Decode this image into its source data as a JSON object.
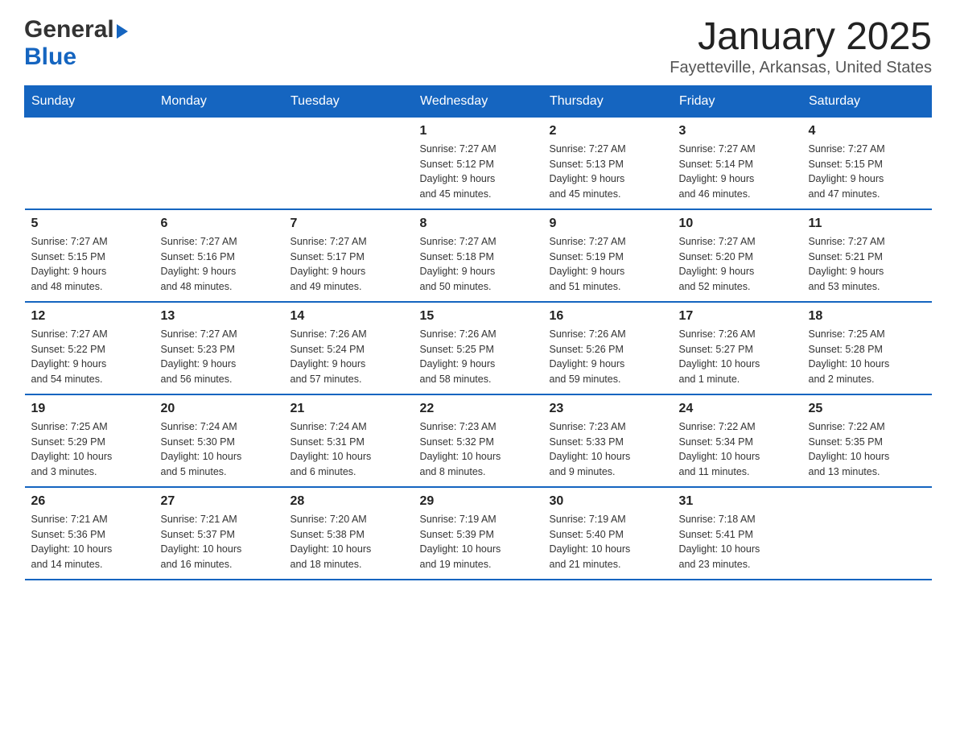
{
  "header": {
    "logo_general": "General",
    "logo_blue": "Blue",
    "title": "January 2025",
    "subtitle": "Fayetteville, Arkansas, United States"
  },
  "days_of_week": [
    "Sunday",
    "Monday",
    "Tuesday",
    "Wednesday",
    "Thursday",
    "Friday",
    "Saturday"
  ],
  "weeks": [
    [
      {
        "day": "",
        "info": ""
      },
      {
        "day": "",
        "info": ""
      },
      {
        "day": "",
        "info": ""
      },
      {
        "day": "1",
        "info": "Sunrise: 7:27 AM\nSunset: 5:12 PM\nDaylight: 9 hours\nand 45 minutes."
      },
      {
        "day": "2",
        "info": "Sunrise: 7:27 AM\nSunset: 5:13 PM\nDaylight: 9 hours\nand 45 minutes."
      },
      {
        "day": "3",
        "info": "Sunrise: 7:27 AM\nSunset: 5:14 PM\nDaylight: 9 hours\nand 46 minutes."
      },
      {
        "day": "4",
        "info": "Sunrise: 7:27 AM\nSunset: 5:15 PM\nDaylight: 9 hours\nand 47 minutes."
      }
    ],
    [
      {
        "day": "5",
        "info": "Sunrise: 7:27 AM\nSunset: 5:15 PM\nDaylight: 9 hours\nand 48 minutes."
      },
      {
        "day": "6",
        "info": "Sunrise: 7:27 AM\nSunset: 5:16 PM\nDaylight: 9 hours\nand 48 minutes."
      },
      {
        "day": "7",
        "info": "Sunrise: 7:27 AM\nSunset: 5:17 PM\nDaylight: 9 hours\nand 49 minutes."
      },
      {
        "day": "8",
        "info": "Sunrise: 7:27 AM\nSunset: 5:18 PM\nDaylight: 9 hours\nand 50 minutes."
      },
      {
        "day": "9",
        "info": "Sunrise: 7:27 AM\nSunset: 5:19 PM\nDaylight: 9 hours\nand 51 minutes."
      },
      {
        "day": "10",
        "info": "Sunrise: 7:27 AM\nSunset: 5:20 PM\nDaylight: 9 hours\nand 52 minutes."
      },
      {
        "day": "11",
        "info": "Sunrise: 7:27 AM\nSunset: 5:21 PM\nDaylight: 9 hours\nand 53 minutes."
      }
    ],
    [
      {
        "day": "12",
        "info": "Sunrise: 7:27 AM\nSunset: 5:22 PM\nDaylight: 9 hours\nand 54 minutes."
      },
      {
        "day": "13",
        "info": "Sunrise: 7:27 AM\nSunset: 5:23 PM\nDaylight: 9 hours\nand 56 minutes."
      },
      {
        "day": "14",
        "info": "Sunrise: 7:26 AM\nSunset: 5:24 PM\nDaylight: 9 hours\nand 57 minutes."
      },
      {
        "day": "15",
        "info": "Sunrise: 7:26 AM\nSunset: 5:25 PM\nDaylight: 9 hours\nand 58 minutes."
      },
      {
        "day": "16",
        "info": "Sunrise: 7:26 AM\nSunset: 5:26 PM\nDaylight: 9 hours\nand 59 minutes."
      },
      {
        "day": "17",
        "info": "Sunrise: 7:26 AM\nSunset: 5:27 PM\nDaylight: 10 hours\nand 1 minute."
      },
      {
        "day": "18",
        "info": "Sunrise: 7:25 AM\nSunset: 5:28 PM\nDaylight: 10 hours\nand 2 minutes."
      }
    ],
    [
      {
        "day": "19",
        "info": "Sunrise: 7:25 AM\nSunset: 5:29 PM\nDaylight: 10 hours\nand 3 minutes."
      },
      {
        "day": "20",
        "info": "Sunrise: 7:24 AM\nSunset: 5:30 PM\nDaylight: 10 hours\nand 5 minutes."
      },
      {
        "day": "21",
        "info": "Sunrise: 7:24 AM\nSunset: 5:31 PM\nDaylight: 10 hours\nand 6 minutes."
      },
      {
        "day": "22",
        "info": "Sunrise: 7:23 AM\nSunset: 5:32 PM\nDaylight: 10 hours\nand 8 minutes."
      },
      {
        "day": "23",
        "info": "Sunrise: 7:23 AM\nSunset: 5:33 PM\nDaylight: 10 hours\nand 9 minutes."
      },
      {
        "day": "24",
        "info": "Sunrise: 7:22 AM\nSunset: 5:34 PM\nDaylight: 10 hours\nand 11 minutes."
      },
      {
        "day": "25",
        "info": "Sunrise: 7:22 AM\nSunset: 5:35 PM\nDaylight: 10 hours\nand 13 minutes."
      }
    ],
    [
      {
        "day": "26",
        "info": "Sunrise: 7:21 AM\nSunset: 5:36 PM\nDaylight: 10 hours\nand 14 minutes."
      },
      {
        "day": "27",
        "info": "Sunrise: 7:21 AM\nSunset: 5:37 PM\nDaylight: 10 hours\nand 16 minutes."
      },
      {
        "day": "28",
        "info": "Sunrise: 7:20 AM\nSunset: 5:38 PM\nDaylight: 10 hours\nand 18 minutes."
      },
      {
        "day": "29",
        "info": "Sunrise: 7:19 AM\nSunset: 5:39 PM\nDaylight: 10 hours\nand 19 minutes."
      },
      {
        "day": "30",
        "info": "Sunrise: 7:19 AM\nSunset: 5:40 PM\nDaylight: 10 hours\nand 21 minutes."
      },
      {
        "day": "31",
        "info": "Sunrise: 7:18 AM\nSunset: 5:41 PM\nDaylight: 10 hours\nand 23 minutes."
      },
      {
        "day": "",
        "info": ""
      }
    ]
  ]
}
